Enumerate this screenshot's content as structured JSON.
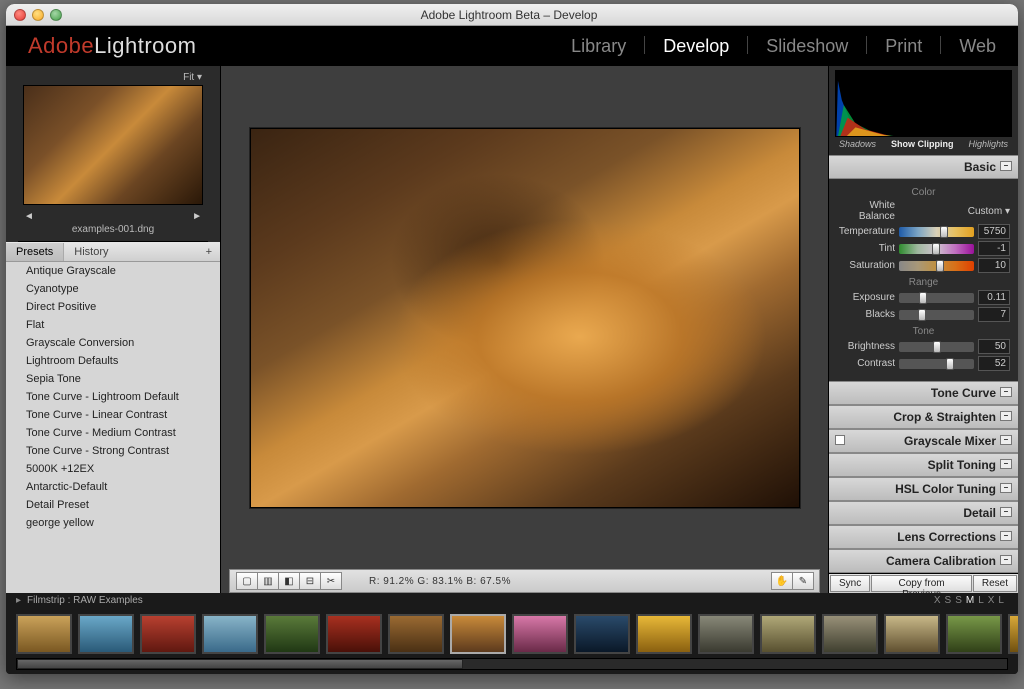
{
  "window": {
    "title": "Adobe Lightroom Beta – Develop"
  },
  "logo": {
    "adobe": "Adobe",
    "lightroom": "Lightroom"
  },
  "nav": {
    "items": [
      "Library",
      "Develop",
      "Slideshow",
      "Print",
      "Web"
    ],
    "active": 1
  },
  "left": {
    "fit_label": "Fit ▾",
    "filename": "examples-001.dng",
    "tabs": {
      "a": "Presets",
      "b": "History",
      "plus": "+"
    },
    "presets": [
      "Antique Grayscale",
      "Cyanotype",
      "Direct Positive",
      "Flat",
      "Grayscale Conversion",
      "Lightroom Defaults",
      "Sepia Tone",
      "Tone Curve - Lightroom Default",
      "Tone Curve - Linear Contrast",
      "Tone Curve - Medium Contrast",
      "Tone Curve - Strong Contrast",
      "5000K +12EX",
      "Antarctic-Default",
      "Detail Preset",
      "george yellow"
    ]
  },
  "toolbar": {
    "rgb": "R:  91.2%   G:  83.1%   B:  67.5%"
  },
  "histogram": {
    "shadows": "Shadows",
    "clip": "Show Clipping",
    "highlights": "Highlights"
  },
  "basic": {
    "title": "Basic",
    "wb_label": "White Balance",
    "wb_value": "Custom ▾",
    "sub_color": "Color",
    "sub_range": "Range",
    "sub_tone": "Tone",
    "rows": {
      "temperature": {
        "lbl": "Temperature",
        "val": "5750",
        "pos": 60
      },
      "tint": {
        "lbl": "Tint",
        "val": "-1",
        "pos": 49
      },
      "saturation": {
        "lbl": "Saturation",
        "val": "10",
        "pos": 55
      },
      "exposure": {
        "lbl": "Exposure",
        "val": "0.11",
        "pos": 32
      },
      "blacks": {
        "lbl": "Blacks",
        "val": "7",
        "pos": 30
      },
      "brightness": {
        "lbl": "Brightness",
        "val": "50",
        "pos": 50
      },
      "contrast": {
        "lbl": "Contrast",
        "val": "52",
        "pos": 68
      }
    }
  },
  "sections": [
    "Tone Curve",
    "Crop & Straighten",
    "Grayscale Mixer",
    "Split Toning",
    "HSL Color Tuning",
    "Detail",
    "Lens Corrections",
    "Camera Calibration"
  ],
  "actions": {
    "sync": "Sync",
    "copy": "Copy from Previous",
    "reset": "Reset"
  },
  "filmstrip": {
    "label": "Filmstrip :",
    "collection": "RAW Examples",
    "sizes": [
      "XS",
      "S",
      "M",
      "L",
      "XL"
    ],
    "active_size": 2,
    "selected": 7
  }
}
